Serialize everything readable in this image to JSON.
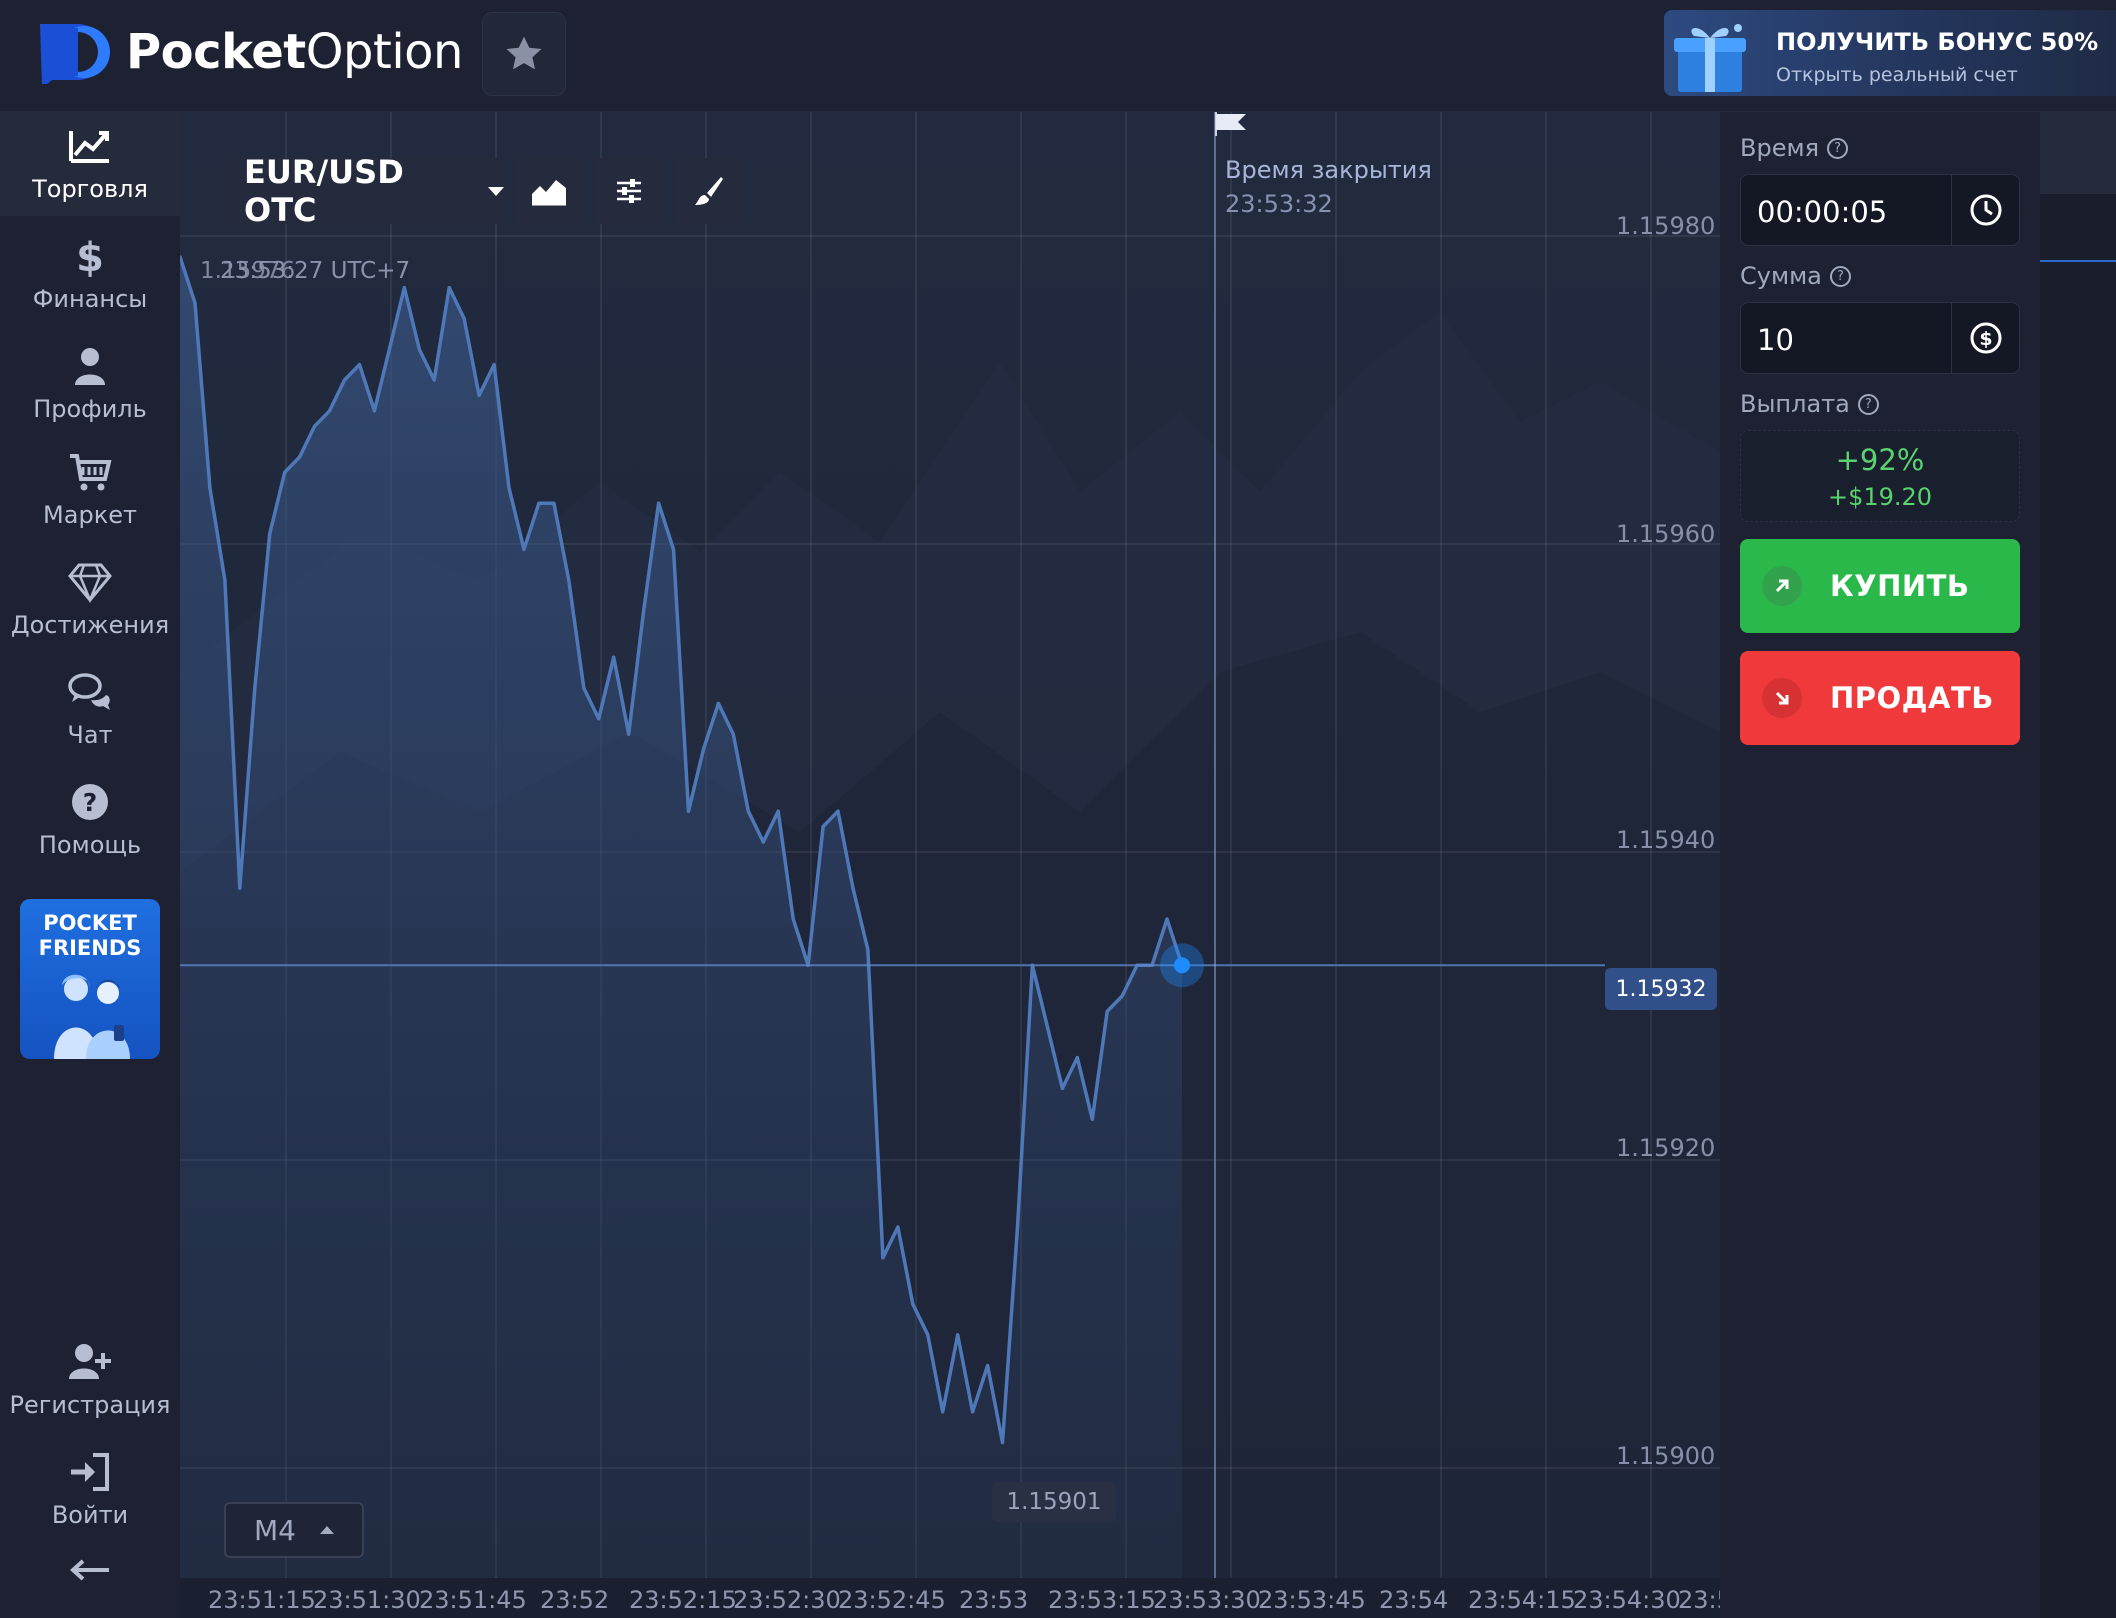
{
  "header": {
    "brand_bold": "Pocket",
    "brand_light": "Option",
    "bonus_title": "ПОЛУЧИТЬ БОНУС 50%",
    "bonus_subtitle": "Открыть реальный счет",
    "favorite_icon": "star-icon"
  },
  "sidebar": {
    "items": [
      {
        "label": "Торговля",
        "icon": "chart-line-icon"
      },
      {
        "label": "Финансы",
        "icon": "dollar-icon"
      },
      {
        "label": "Профиль",
        "icon": "user-icon"
      },
      {
        "label": "Маркет",
        "icon": "cart-icon"
      },
      {
        "label": "Достижения",
        "icon": "diamond-icon"
      },
      {
        "label": "Чат",
        "icon": "chat-icon"
      },
      {
        "label": "Помощь",
        "icon": "help-icon"
      }
    ],
    "friends_line1": "POCKET",
    "friends_line2": "FRIENDS",
    "register_label": "Регистрация",
    "login_label": "Войти",
    "collapse_icon": "arrow-left-icon"
  },
  "chart": {
    "asset": "EUR/USD OTC",
    "clock_overlay": "1.15976",
    "clock": "23:53:27 UTC+7",
    "close_title": "Время закрытия",
    "close_time": "23:53:32",
    "current_price": "1.15932",
    "min_price": "1.15901",
    "timeframe": "M4",
    "colors": {
      "line": "#4f78b8",
      "marker": "#1e8cff",
      "background": "#1c2234"
    }
  },
  "chart_data": {
    "type": "area",
    "series": [
      {
        "values": [
          1.15978,
          1.15975,
          1.15963,
          1.15957,
          1.15937,
          1.1595,
          1.1596,
          1.15964,
          1.15965,
          1.15967,
          1.15968,
          1.1597,
          1.15971,
          1.15968,
          1.15972,
          1.15976,
          1.15972,
          1.1597,
          1.15976,
          1.15974,
          1.15969,
          1.15971,
          1.15963,
          1.15959,
          1.15962,
          1.15962,
          1.15957,
          1.1595,
          1.15948,
          1.15952,
          1.15947,
          1.15955,
          1.15962,
          1.15959,
          1.15942,
          1.15946,
          1.15949,
          1.15947,
          1.15942,
          1.1594,
          1.15942,
          1.15935,
          1.15932,
          1.15941,
          1.15942,
          1.15937,
          1.15933,
          1.15913,
          1.15915,
          1.1591,
          1.15908,
          1.15903,
          1.15908,
          1.15903,
          1.15906,
          1.15901,
          1.15915,
          1.15932,
          1.15928,
          1.15924,
          1.15926,
          1.15922,
          1.15929,
          1.1593,
          1.15932,
          1.15932,
          1.15935,
          1.15932
        ]
      }
    ],
    "x_tick_labels": [
      "23:51:15",
      "23:51:30",
      "23:51:45",
      "23:52",
      "23:52:15",
      "23:52:30",
      "23:52:45",
      "23:53",
      "23:53:15",
      "23:53:30",
      "23:53:45",
      "23:54",
      "23:54:15",
      "23:54:30",
      "23:5"
    ],
    "y_tick_labels": [
      "1.15980",
      "1.15960",
      "1.15940",
      "1.15920",
      "1.15900"
    ],
    "ylim": [
      1.15898,
      1.15982
    ],
    "x_range": [
      "23:51:11",
      "23:53:27"
    ],
    "current_value": 1.15932,
    "min_value": 1.15901,
    "close_time": "23:53:32",
    "grid": true,
    "area_fill": true
  },
  "panel": {
    "time_label": "Время",
    "time_value": "00:00:05",
    "amount_label": "Сумма",
    "amount_value": "10",
    "payout_label": "Выплата",
    "payout_percent": "+92%",
    "payout_amount": "+$19.20",
    "buy_label": "КУПИТЬ",
    "sell_label": "ПРОДАТЬ",
    "colors": {
      "buy": "#2bb84a",
      "sell": "#f0393a",
      "payout": "#58d36d"
    }
  }
}
